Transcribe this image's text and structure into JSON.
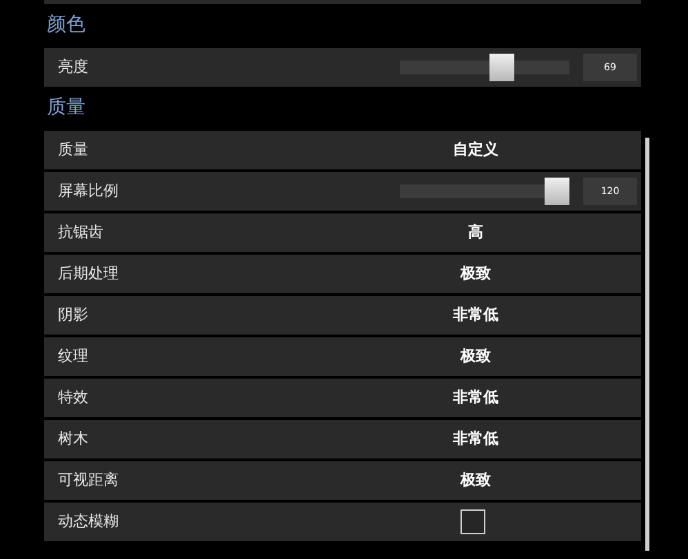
{
  "sections": [
    {
      "title": "颜色",
      "rows": [
        {
          "kind": "slider",
          "label": "亮度",
          "level": 0.62,
          "value": "69"
        }
      ]
    },
    {
      "title": "质量",
      "rows": [
        {
          "kind": "choice",
          "label": "质量",
          "value": "自定义"
        },
        {
          "kind": "slider",
          "label": "屏幕比例",
          "level": 1,
          "value": "120"
        },
        {
          "kind": "choice",
          "label": "抗锯齿",
          "value": "高"
        },
        {
          "kind": "choice",
          "label": "后期处理",
          "value": "极致"
        },
        {
          "kind": "choice",
          "label": "阴影",
          "value": "非常低"
        },
        {
          "kind": "choice",
          "label": "纹理",
          "value": "极致"
        },
        {
          "kind": "choice",
          "label": "特效",
          "value": "非常低"
        },
        {
          "kind": "choice",
          "label": "树木",
          "value": "非常低"
        },
        {
          "kind": "choice",
          "label": "可视距离",
          "value": "极致"
        },
        {
          "kind": "checkbox",
          "label": "动态模糊",
          "checked": false
        }
      ]
    }
  ]
}
